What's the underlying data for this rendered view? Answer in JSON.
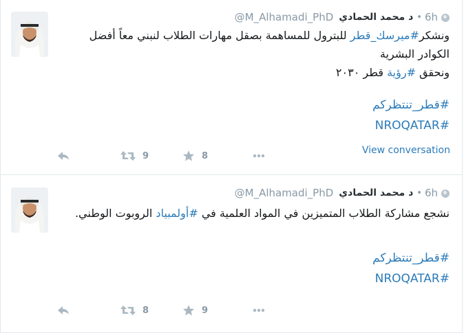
{
  "tweets": [
    {
      "time": "6h",
      "separator": "•",
      "full_name": "د محمد الحمادي",
      "screen_name": "@M_Alhamadi_PhD",
      "text_line_1_before": "ونشكر",
      "text_line_1_hashtag": "#ميرسك_قطر",
      "text_line_1_after": " للبترول للمساهمة بصقل مهارات الطلاب لنبني معاً أفضل الكوادر البشرية",
      "text_line_2_before": "ونحقق ",
      "text_line_2_hashtag": "#رؤية",
      "text_line_2_after": " قطر ٢٠٣٠",
      "tags": [
        "#قطر_تنتظركم",
        "#NROQATAR"
      ],
      "view_conversation": "View conversation",
      "actions": {
        "retweets": "9",
        "favorites": "8"
      }
    },
    {
      "time": "6h",
      "separator": "•",
      "full_name": "د محمد الحمادي",
      "screen_name": "@M_Alhamadi_PhD",
      "text_before": "نشجع مشاركة الطلاب المتميزين في المواد العلمية في ",
      "text_hashtag": "#أولمبياد",
      "text_after": " الروبوت الوطني.",
      "tags": [
        "#قطر_تنتظركم",
        "#NROQATAR"
      ],
      "actions": {
        "retweets": "8",
        "favorites": "9"
      }
    }
  ],
  "colors": {
    "link": "#2b7bb9",
    "meta": "#8899a6",
    "border": "#e1e8ed"
  },
  "icons": [
    "globe-icon",
    "avatar",
    "reply-icon",
    "retweet-icon",
    "favorite-icon",
    "more-icon"
  ]
}
